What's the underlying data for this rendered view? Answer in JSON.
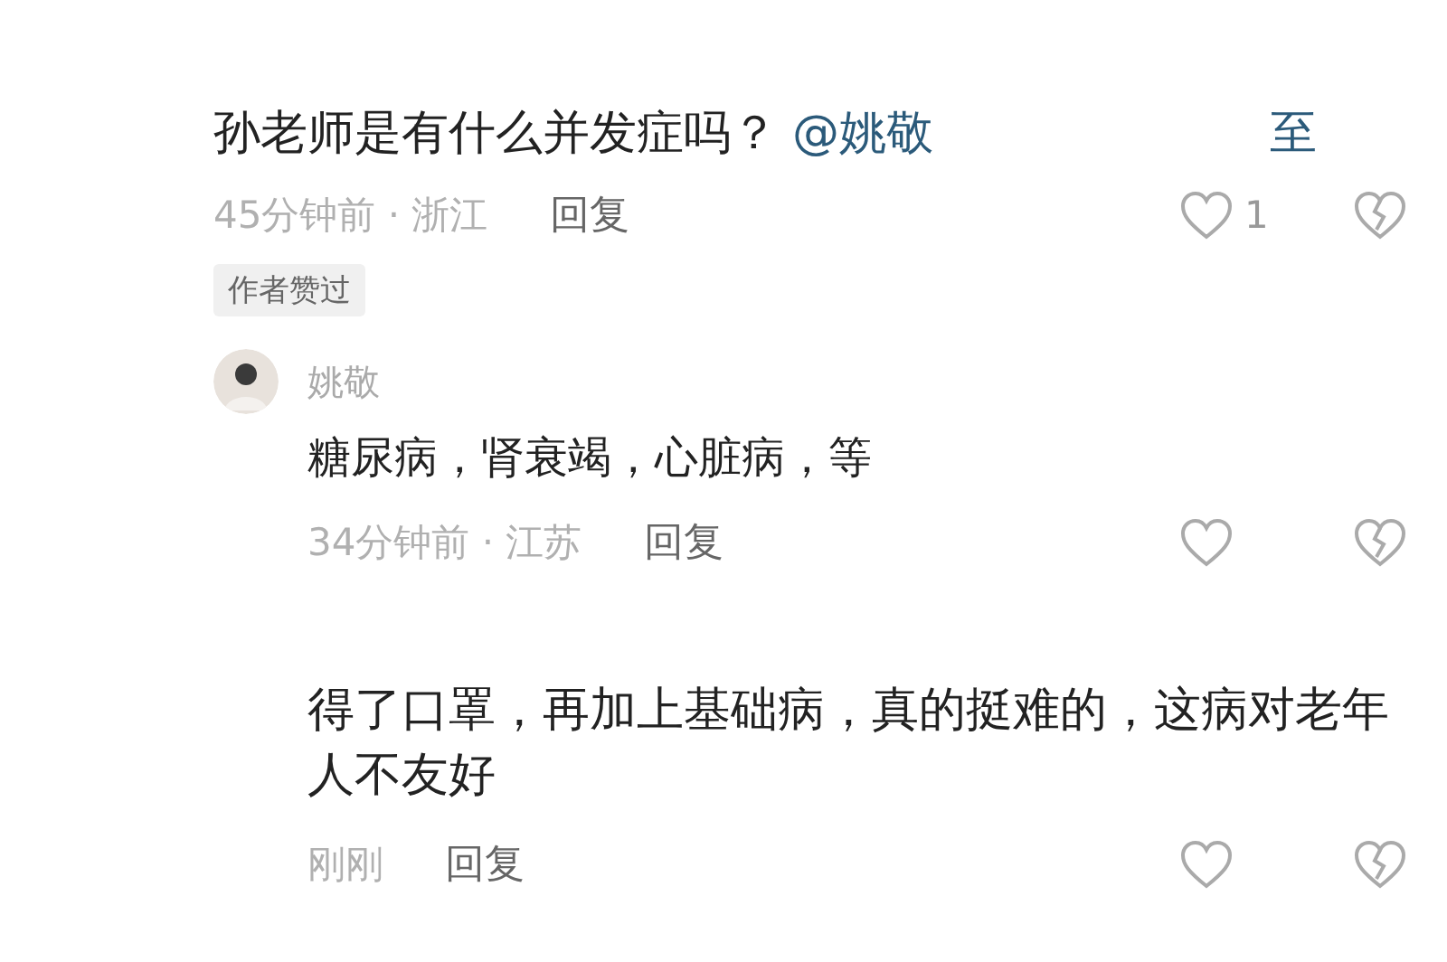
{
  "comments": [
    {
      "text": "孙老师是有什么并发症吗？",
      "mention": "@姚敬",
      "mention_tail": "至",
      "time": "45分钟前 · 浙江",
      "reply": "回复",
      "likes": "1",
      "badge": "作者赞过",
      "replies": [
        {
          "author": "姚敬",
          "text": "糖尿病，肾衰竭，心脏病，等",
          "time": "34分钟前 · 江苏",
          "reply": "回复"
        }
      ]
    },
    {
      "text": "得了口罩，再加上基础病，真的挺难的，这病对老年人不友好",
      "time": "刚刚",
      "reply": "回复"
    }
  ]
}
